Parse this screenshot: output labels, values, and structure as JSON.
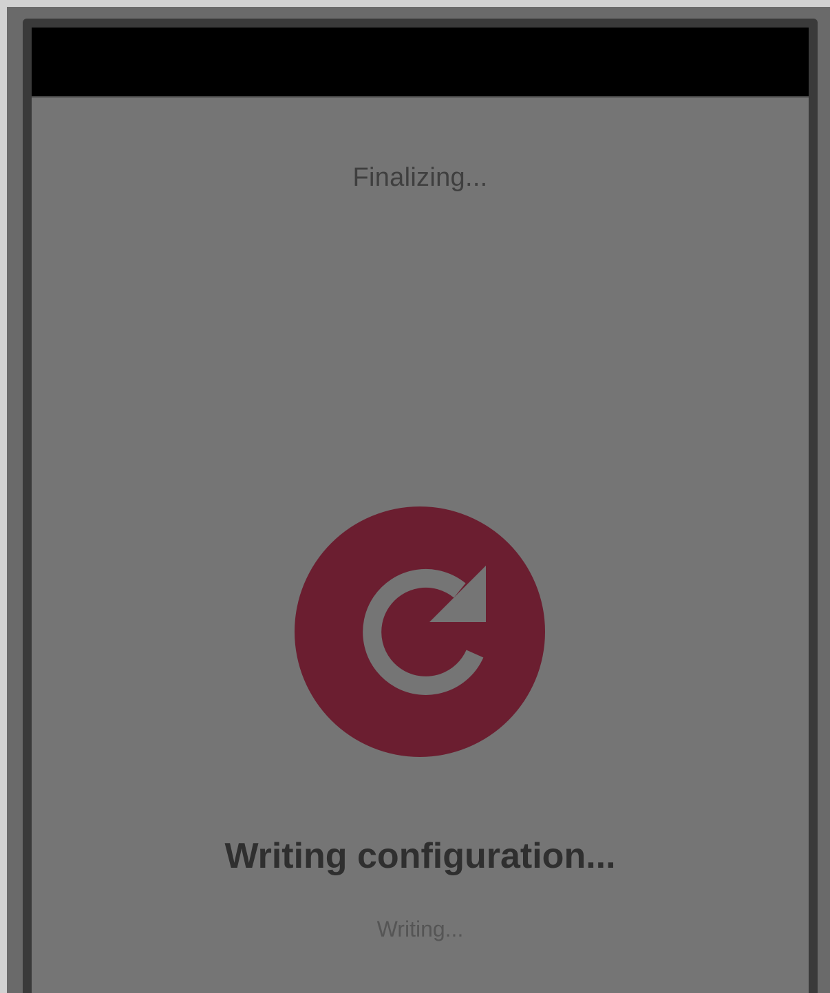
{
  "installer": {
    "step_title": "Finalizing...",
    "status_heading": "Writing configuration...",
    "status_detail": "Writing...",
    "spinner_icon": "refresh-icon"
  },
  "colors": {
    "accent": "#6b1e30",
    "content_background": "#757575",
    "header_background": "#000000"
  }
}
